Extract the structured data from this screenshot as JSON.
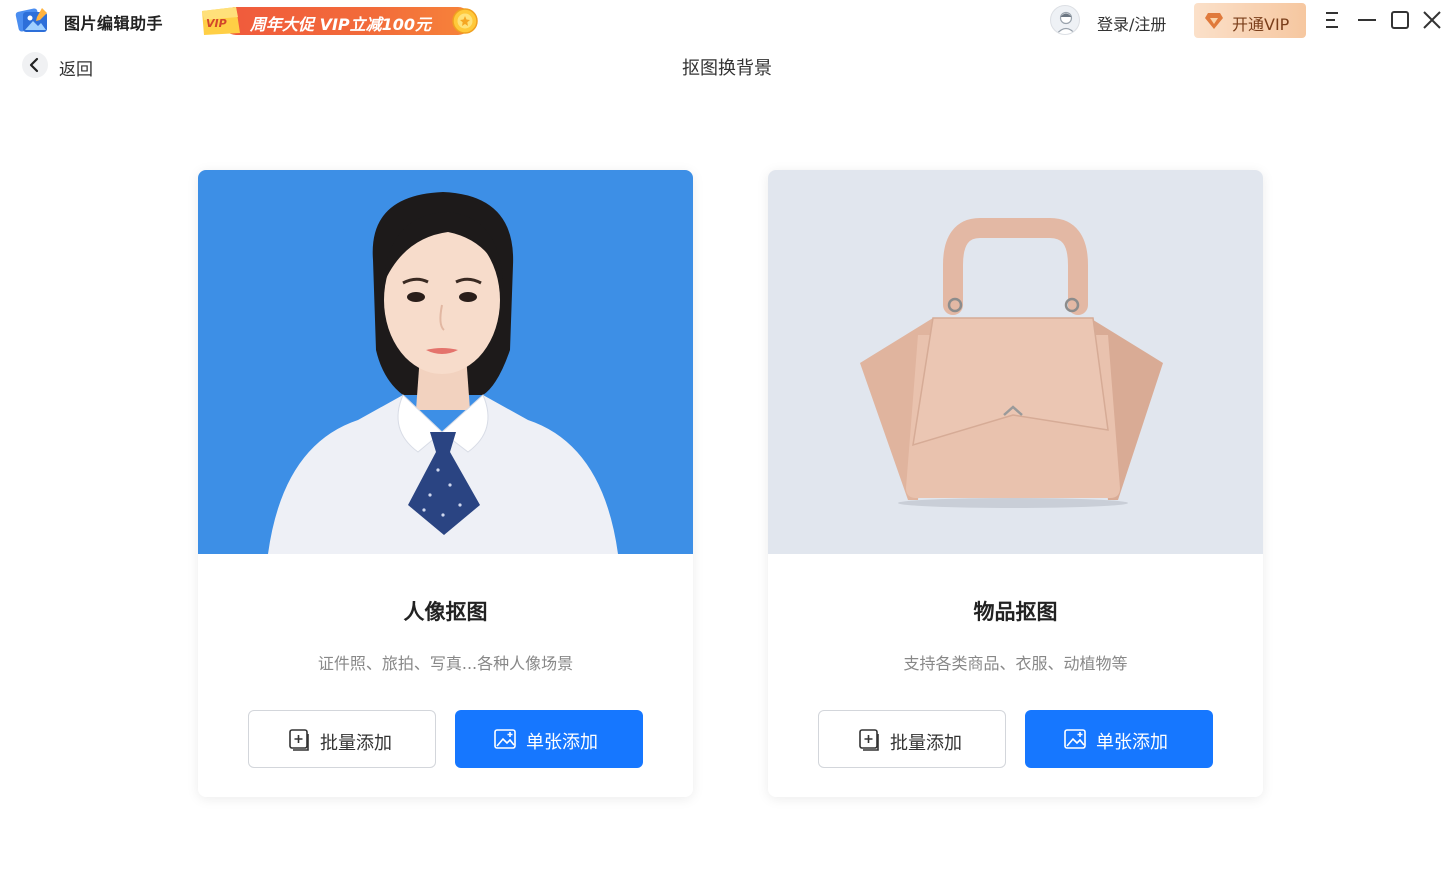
{
  "app": {
    "name": "图片编辑助手",
    "logo_icon": "app-logo-icon"
  },
  "promo": {
    "badge": "VIP",
    "text": "周年大促 VIP立减100元"
  },
  "account": {
    "login_label": "登录/注册",
    "vip_label": "开通VIP"
  },
  "window_controls": [
    "menu-icon",
    "minimize-icon",
    "maximize-icon",
    "close-icon"
  ],
  "header": {
    "back_label": "返回",
    "page_title": "抠图换背景"
  },
  "cards": [
    {
      "title": "人像抠图",
      "desc": "证件照、旅拍、写真...各种人像场景",
      "image_bg": "#3d8fe6",
      "batch_label": "批量添加",
      "single_label": "单张添加"
    },
    {
      "title": "物品抠图",
      "desc": "支持各类商品、衣服、动植物等",
      "image_bg": "#e1e6ee",
      "batch_label": "批量添加",
      "single_label": "单张添加"
    }
  ],
  "colors": {
    "primary": "#1677ff",
    "promo": "#f26b3a",
    "vip_gold": "#f6c7a0"
  }
}
